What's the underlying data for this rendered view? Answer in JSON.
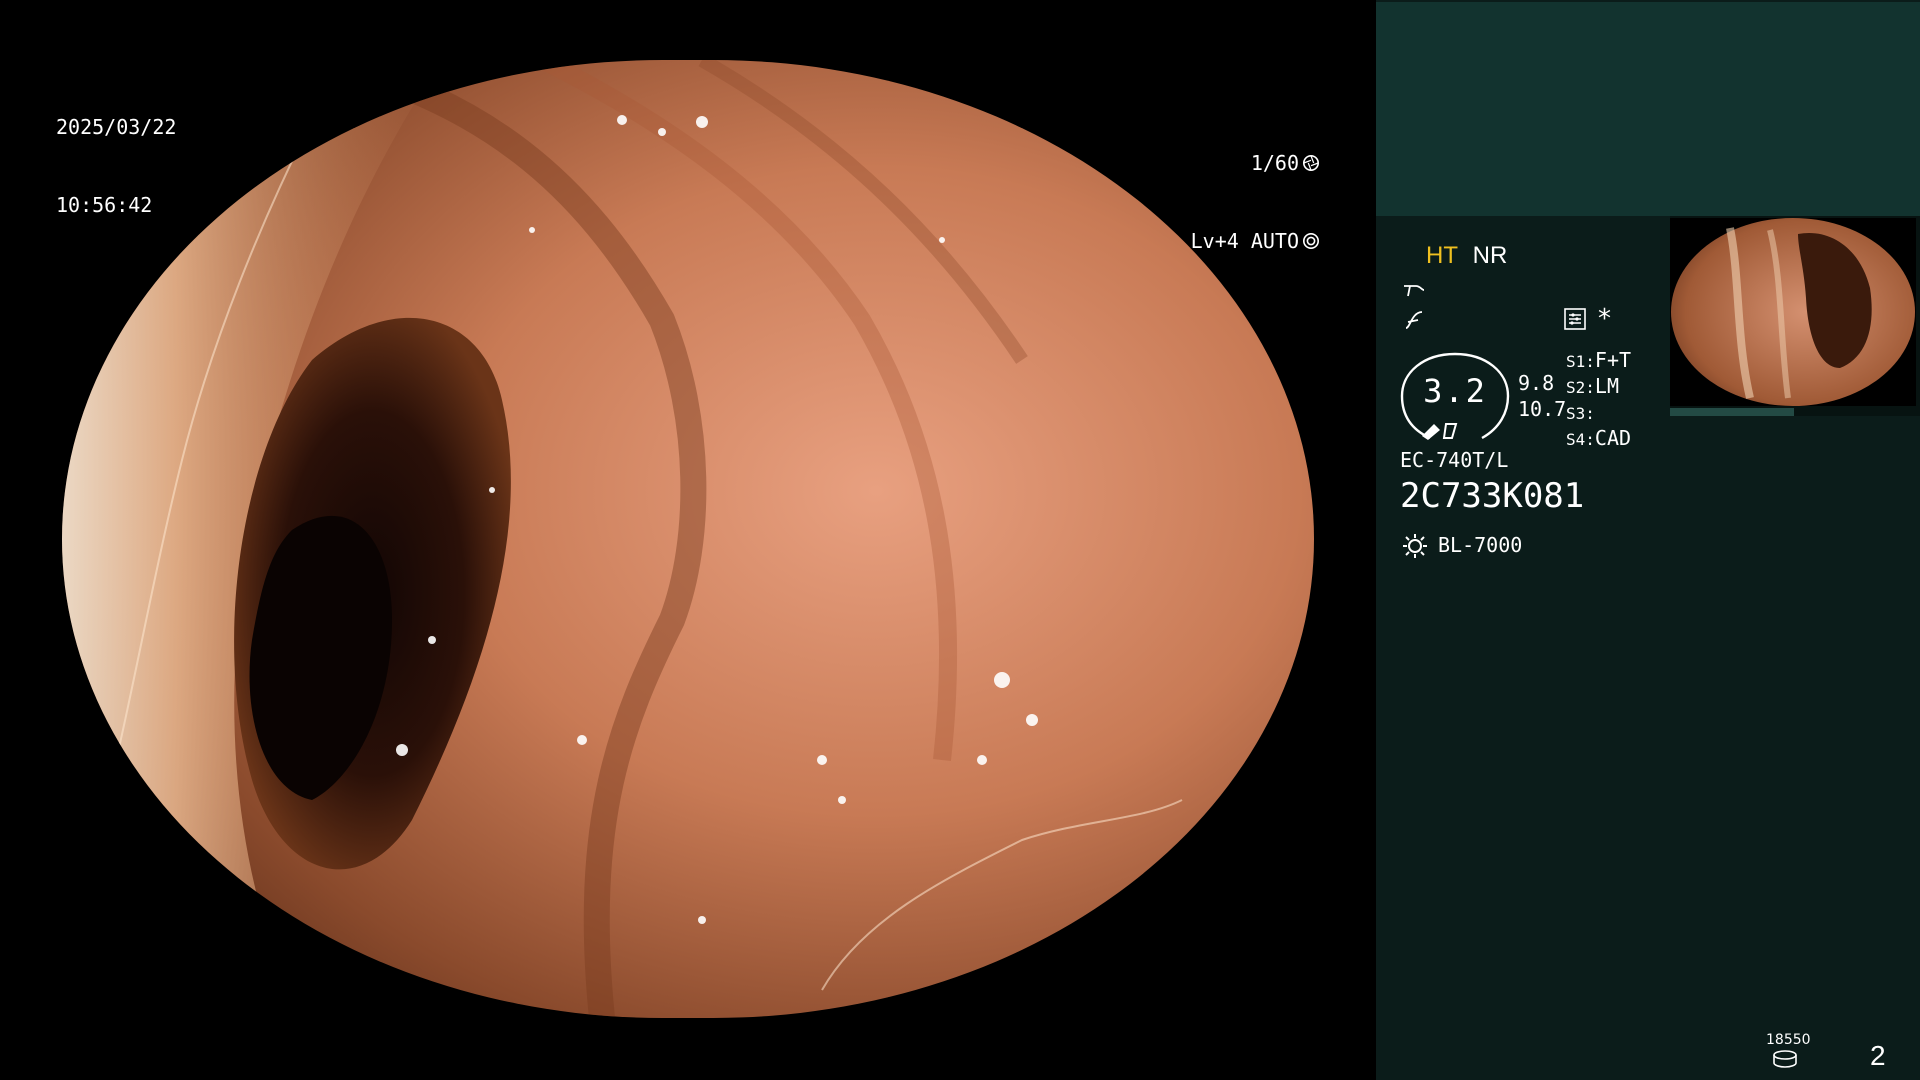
{
  "osd": {
    "date": "2025/03/22",
    "time": "10:56:42",
    "shutter": "1/60",
    "level": "Lv+4 AUTO"
  },
  "panel": {
    "mode_ht": "HT",
    "mode_nr": "NR",
    "magnification": "3.2",
    "mag_side_1": "9.8",
    "mag_side_2": "10.7",
    "switches": [
      {
        "key": "S1:",
        "value": "F+T"
      },
      {
        "key": "S2:",
        "value": "LM"
      },
      {
        "key": "S3:",
        "value": ""
      },
      {
        "key": "S4:",
        "value": "CAD"
      }
    ],
    "scope_model": "EC-740T/L",
    "scope_serial": "2C733K081",
    "light_source": "BL-7000",
    "star": "*",
    "counter": "18550",
    "page_number": "2"
  },
  "colors": {
    "panel_bg": "#0b1c1a",
    "panel_top": "#12332f",
    "accent_ht": "#f0c020"
  }
}
